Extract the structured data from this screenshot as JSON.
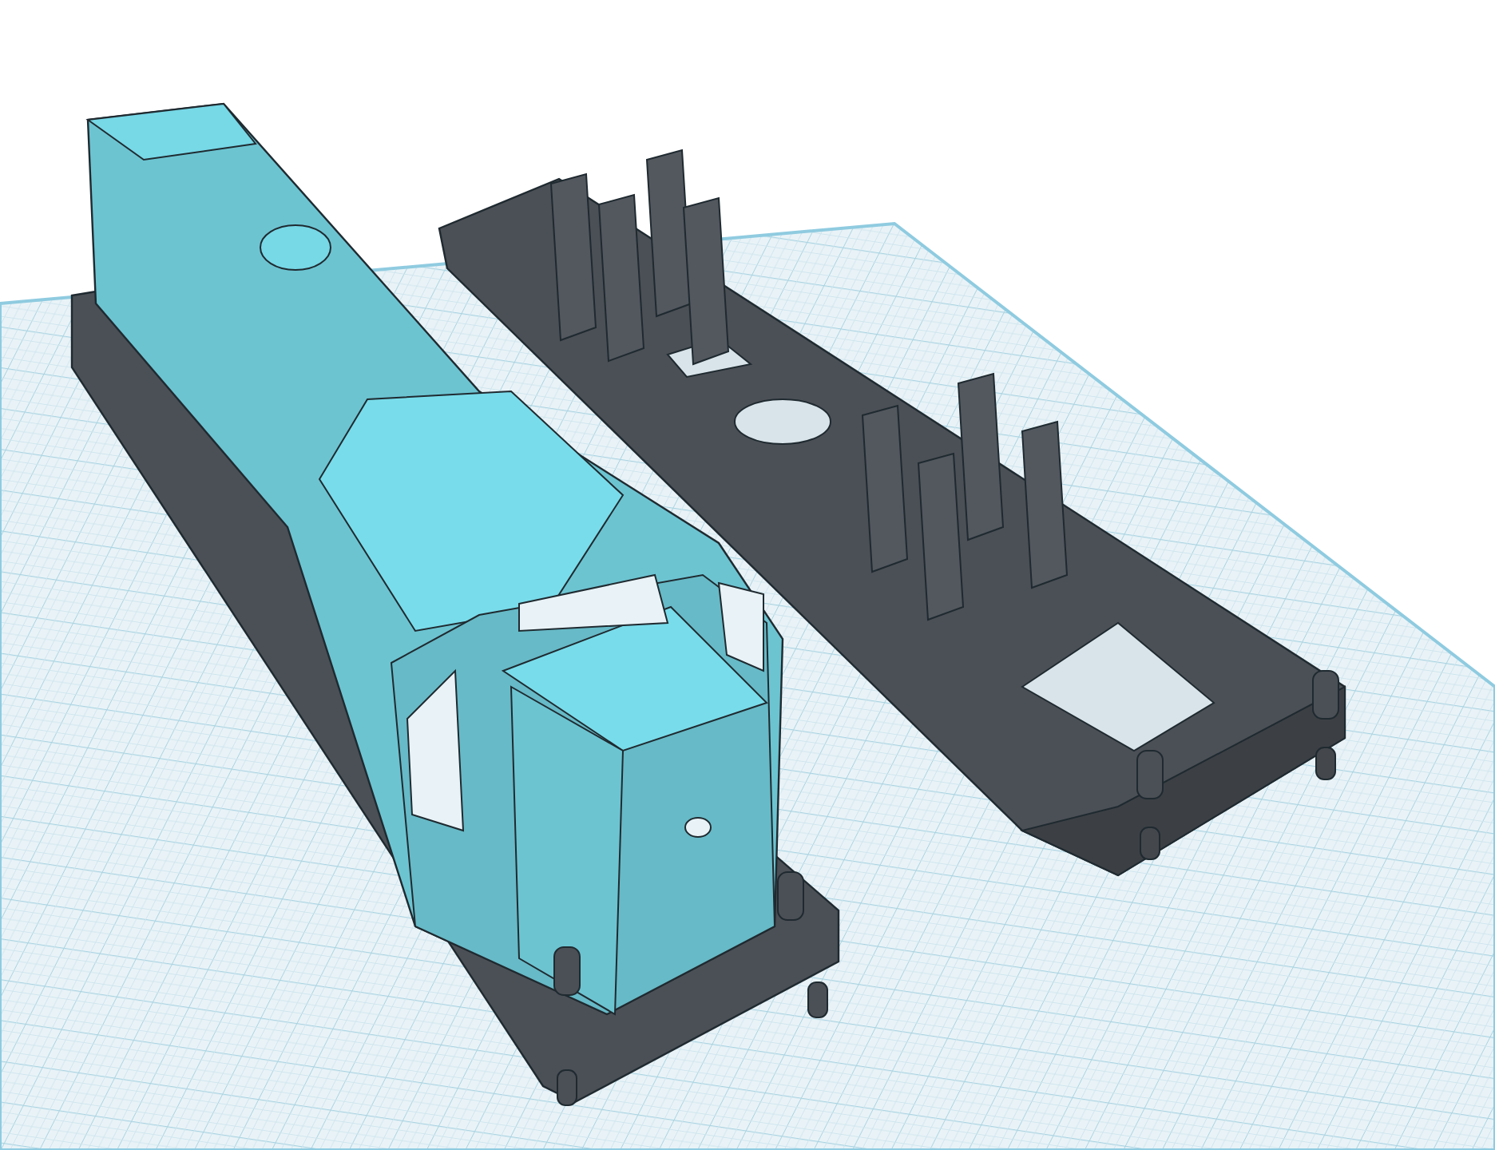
{
  "workplane": {
    "kind": "grid"
  },
  "models": [
    {
      "kind": "locomotive-body",
      "color": "#6cc4d1"
    },
    {
      "kind": "chassis",
      "color": "#4b5056"
    }
  ]
}
